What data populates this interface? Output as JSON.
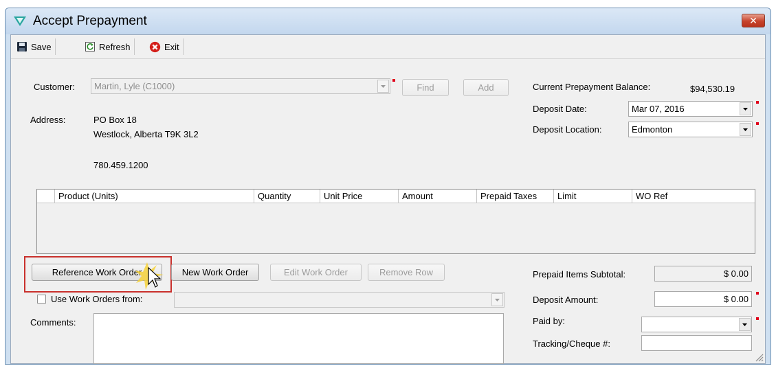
{
  "window": {
    "title": "Accept Prepayment",
    "close_label": "✕"
  },
  "toolbar": {
    "save_label": "Save",
    "refresh_label": "Refresh",
    "exit_label": "Exit"
  },
  "customer": {
    "label": "Customer:",
    "value": "Martin, Lyle (C1000)",
    "find_label": "Find",
    "add_label": "Add"
  },
  "address": {
    "label": "Address:",
    "line1": "PO Box 18",
    "line2": "Westlock, Alberta T9K 3L2",
    "phone": "780.459.1200"
  },
  "balance": {
    "label": "Current Prepayment Balance:",
    "value": "$94,530.19"
  },
  "deposit_date": {
    "label": "Deposit Date:",
    "value": "Mar 07, 2016"
  },
  "deposit_location": {
    "label": "Deposit Location:",
    "value": "Edmonton"
  },
  "grid": {
    "columns": [
      "Product (Units)",
      "Quantity",
      "Unit Price",
      "Amount",
      "Prepaid Taxes",
      "Limit",
      "WO Ref"
    ]
  },
  "buttons": {
    "reference_work_order": "Reference Work Order",
    "new_work_order": "New Work Order",
    "edit_work_order": "Edit Work Order",
    "remove_row": "Remove Row"
  },
  "use_work_orders": {
    "label": "Use Work Orders from:",
    "value": ""
  },
  "comments": {
    "label": "Comments:",
    "value": ""
  },
  "subtotal": {
    "label": "Prepaid Items Subtotal:",
    "value": "$ 0.00"
  },
  "deposit_amount": {
    "label": "Deposit Amount:",
    "value": "$ 0.00"
  },
  "paid_by": {
    "label": "Paid by:",
    "value": ""
  },
  "tracking": {
    "label": "Tracking/Cheque #:",
    "value": ""
  },
  "colors": {
    "required_marker": "#e0001b",
    "highlight_box": "#c9302c"
  }
}
